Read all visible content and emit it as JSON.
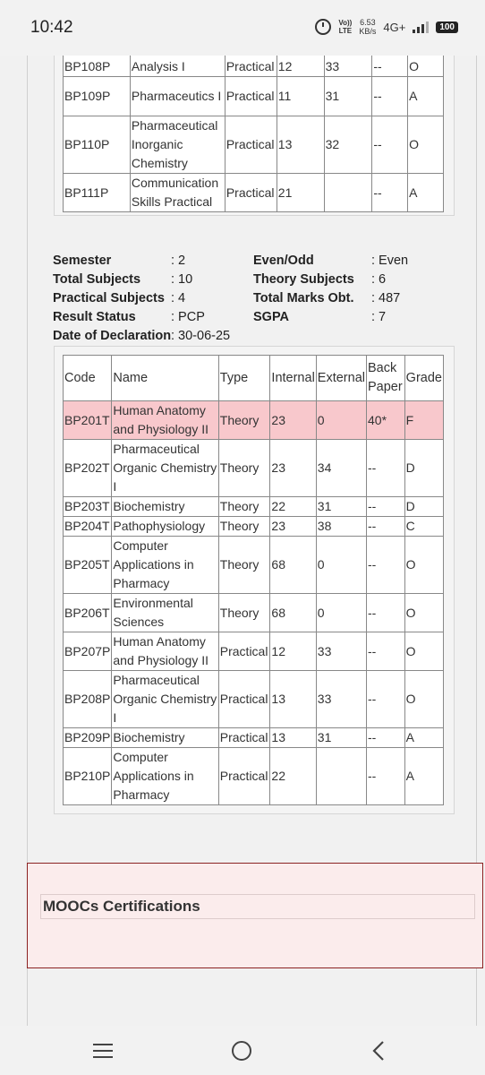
{
  "status_bar": {
    "time": "10:42",
    "volte_top": "Vo))",
    "volte_bottom": "LTE",
    "speed_value": "6.53",
    "speed_unit": "KB/s",
    "network": "4G+",
    "battery": "100"
  },
  "semester1_table": {
    "rows": [
      {
        "code": "BP108P",
        "name": "Pharmaceutical Analysis I",
        "type": "Practical",
        "internal": "12",
        "external": "33",
        "back": "--",
        "grade": "O",
        "partial": true
      },
      {
        "code": "BP109P",
        "name": "Pharmaceutics I",
        "type": "Practical",
        "internal": "11",
        "external": "31",
        "back": "--",
        "grade": "A"
      },
      {
        "code": "BP110P",
        "name": "Pharmaceutical Inorganic Chemistry",
        "type": "Practical",
        "internal": "13",
        "external": "32",
        "back": "--",
        "grade": "O"
      },
      {
        "code": "BP111P",
        "name": "Communication Skills Practical",
        "type": "Practical",
        "internal": "21",
        "external": "",
        "back": "--",
        "grade": "A"
      }
    ]
  },
  "semester2_summary": {
    "semester_label": "Semester",
    "semester_value": ": 2",
    "even_odd_label": "Even/Odd",
    "even_odd_value": ": Even",
    "total_subjects_label": "Total Subjects",
    "total_subjects_value": ": 10",
    "theory_subjects_label": "Theory Subjects",
    "theory_subjects_value": ": 6",
    "practical_subjects_label": "Practical Subjects",
    "practical_subjects_value": ": 4",
    "total_marks_label": "Total Marks Obt.",
    "total_marks_value": ": 487",
    "result_status_label": "Result Status",
    "result_status_value": ": PCP",
    "sgpa_label": "SGPA",
    "sgpa_value": ": 7",
    "declaration_label": "Date of Declaration",
    "declaration_value": ": 30-06-25"
  },
  "semester2_table": {
    "headers": {
      "code": "Code",
      "name": "Name",
      "type": "Type",
      "internal": "Internal",
      "external": "External",
      "back": "Back Paper",
      "grade": "Grade"
    },
    "rows": [
      {
        "code": "BP201T",
        "name": "Human Anatomy and Physiology II",
        "type": "Theory",
        "internal": "23",
        "external": "0",
        "back": "40*",
        "grade": "F",
        "failed": true
      },
      {
        "code": "BP202T",
        "name": "Pharmaceutical Organic Chemistry I",
        "type": "Theory",
        "internal": "23",
        "external": "34",
        "back": "--",
        "grade": "D"
      },
      {
        "code": "BP203T",
        "name": "Biochemistry",
        "type": "Theory",
        "internal": "22",
        "external": "31",
        "back": "--",
        "grade": "D"
      },
      {
        "code": "BP204T",
        "name": "Pathophysiology",
        "type": "Theory",
        "internal": "23",
        "external": "38",
        "back": "--",
        "grade": "C"
      },
      {
        "code": "BP205T",
        "name": "Computer Applications in Pharmacy",
        "type": "Theory",
        "internal": "68",
        "external": "0",
        "back": "--",
        "grade": "O"
      },
      {
        "code": "BP206T",
        "name": "Environmental Sciences",
        "type": "Theory",
        "internal": "68",
        "external": "0",
        "back": "--",
        "grade": "O"
      },
      {
        "code": "BP207P",
        "name": "Human Anatomy and Physiology II",
        "type": "Practical",
        "internal": "12",
        "external": "33",
        "back": "--",
        "grade": "O"
      },
      {
        "code": "BP208P",
        "name": "Pharmaceutical Organic Chemistry I",
        "type": "Practical",
        "internal": "13",
        "external": "33",
        "back": "--",
        "grade": "O"
      },
      {
        "code": "BP209P",
        "name": "Biochemistry",
        "type": "Practical",
        "internal": "13",
        "external": "31",
        "back": "--",
        "grade": "A"
      },
      {
        "code": "BP210P",
        "name": "Computer Applications in Pharmacy",
        "type": "Practical",
        "internal": "22",
        "external": "",
        "back": "--",
        "grade": "A"
      }
    ]
  },
  "moocs": {
    "title": "MOOCs Certifications"
  },
  "colors": {
    "fail_row": "#f8c8cc",
    "moocs_border": "#8b2222",
    "moocs_bg": "#fbecec"
  },
  "navigation": {
    "icons": [
      "menu-icon",
      "home-icon",
      "back-icon"
    ]
  }
}
